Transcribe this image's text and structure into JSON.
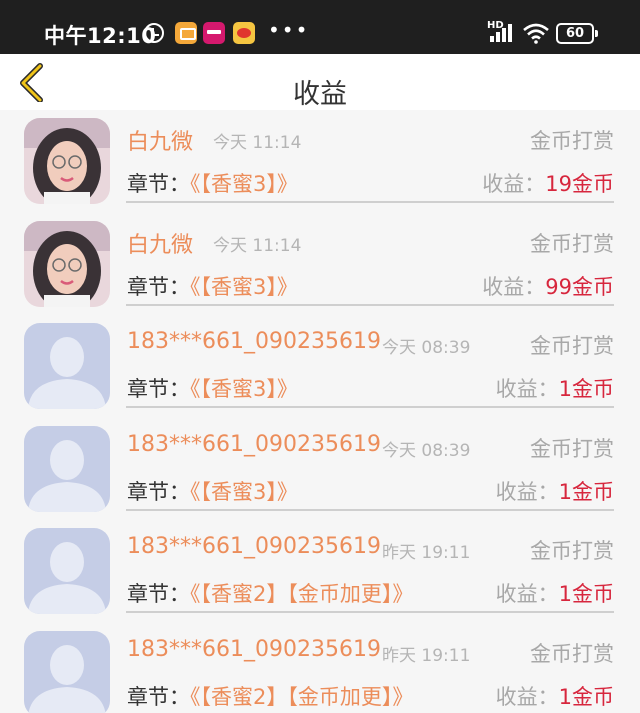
{
  "status_bar": {
    "time": "中午12:10",
    "network": "HD",
    "battery": "60"
  },
  "header": {
    "title": "收益"
  },
  "records": [
    {
      "name": "白九微",
      "time": "今天 11:14",
      "type": "金币打赏",
      "chapter_label": "章节：",
      "chapter": "《【香蜜3】》",
      "income_label": "收益：",
      "income": "19金币",
      "avatar": "photo"
    },
    {
      "name": "白九微",
      "time": "今天 11:14",
      "type": "金币打赏",
      "chapter_label": "章节：",
      "chapter": "《【香蜜3】》",
      "income_label": "收益：",
      "income": "99金币",
      "avatar": "photo"
    },
    {
      "name": "183***661_090235619",
      "time": "今天 08:39",
      "type": "金币打赏",
      "chapter_label": "章节：",
      "chapter": "《【香蜜3】》",
      "income_label": "收益：",
      "income": "1金币",
      "avatar": "default"
    },
    {
      "name": "183***661_090235619",
      "time": "今天 08:39",
      "type": "金币打赏",
      "chapter_label": "章节：",
      "chapter": "《【香蜜3】》",
      "income_label": "收益：",
      "income": "1金币",
      "avatar": "default"
    },
    {
      "name": "183***661_090235619",
      "time": "昨天 19:11",
      "type": "金币打赏",
      "chapter_label": "章节：",
      "chapter": "《【香蜜2】【金币加更】》",
      "income_label": "收益：",
      "income": "1金币",
      "avatar": "default"
    },
    {
      "name": "183***661_090235619",
      "time": "昨天 19:11",
      "type": "金币打赏",
      "chapter_label": "章节：",
      "chapter": "《【香蜜2】【金币加更】》",
      "income_label": "收益：",
      "income": "1金币",
      "avatar": "default"
    }
  ],
  "colors": {
    "accent_orange": "#ec8d5a",
    "income_red": "#d7263d",
    "back_arrow": "#e6b800"
  }
}
